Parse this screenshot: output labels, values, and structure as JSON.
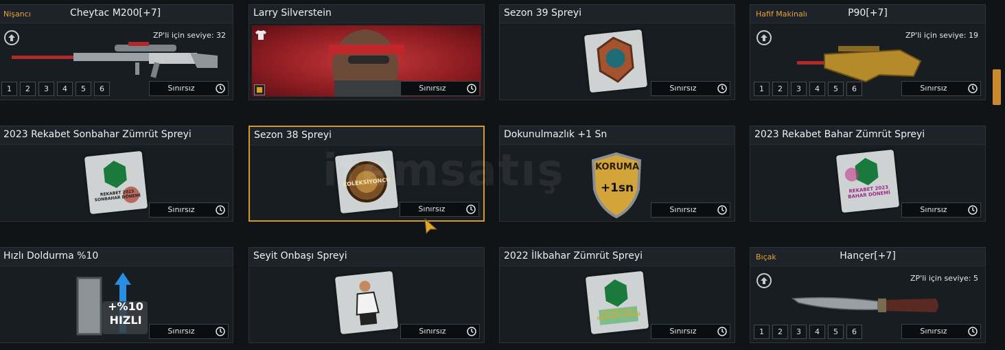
{
  "common": {
    "duration_label": "Sınırsız"
  },
  "items": [
    {
      "title": "Cheytac M200[+7]",
      "category": "Nişancı",
      "level_req": "ZP'li için seviye: 32",
      "levels": [
        "1",
        "2",
        "3",
        "4",
        "5",
        "6"
      ]
    },
    {
      "title": "Larry Silverstein"
    },
    {
      "title": "Sezon 39 Spreyi"
    },
    {
      "title": "P90[+7]",
      "category": "Hafif Makinalı",
      "level_req": "ZP'li için seviye: 19",
      "levels": [
        "1",
        "2",
        "3",
        "4",
        "5",
        "6"
      ]
    },
    {
      "title": "2023 Rekabet Sonbahar Zümrüt Spreyi",
      "spray_text": "REKABET 2023 SONBAHAR DÖNEMİ"
    },
    {
      "title": "Sezon 38 Spreyi",
      "spray_text": "KOLEKSİYONCU"
    },
    {
      "title": "Dokunulmazlık +1 Sn",
      "badge_top": "KORUMA",
      "badge_bottom": "+1sn"
    },
    {
      "title": "2023 Rekabet Bahar Zümrüt Spreyi",
      "spray_text": "REKABET 2023 BAHAR DÖNEMİ"
    },
    {
      "title": "Hızlı Doldurma %10",
      "badge_top": "+%10",
      "badge_bottom": "HIZLI"
    },
    {
      "title": "Seyit Onbaşı Spreyi"
    },
    {
      "title": "2022 İlkbahar Zümrüt Spreyi",
      "spray_text": "REKABET 2022 İLKBAHAR DÖNEMİ"
    },
    {
      "title": "Hançer[+7]",
      "category": "Bıçak",
      "level_req": "ZP'li için seviye: 5",
      "levels": [
        "1",
        "2",
        "3",
        "4",
        "5",
        "6"
      ]
    }
  ],
  "watermark": "itemsatış",
  "colors": {
    "accent": "#d29a2b",
    "category": "#e9a23b",
    "background": "#101417"
  }
}
